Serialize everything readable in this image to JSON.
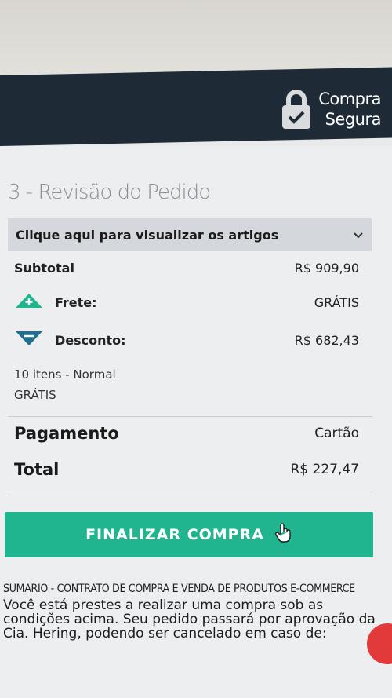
{
  "header": {
    "secure_line1": "Compra",
    "secure_line2": "Segura"
  },
  "review": {
    "step_title": "3 - Revisão do Pedido",
    "items_toggle_label": "Clique aqui para visualizar os artigos",
    "subtotal_label": "Subtotal",
    "subtotal_value": "R$ 909,90",
    "frete_label": "Frete:",
    "frete_value": "GRÁTIS",
    "desconto_label": "Desconto:",
    "desconto_value": "R$ 682,43",
    "shipping_info": "10 itens - Normal",
    "shipping_price": "GRÁTIS",
    "pagamento_label": "Pagamento",
    "pagamento_value": "Cartão",
    "total_label": "Total",
    "total_value": "R$ 227,47"
  },
  "actions": {
    "finalize_label": "FINALIZAR COMPRA"
  },
  "contract": {
    "title": "SUMARIO - CONTRATO DE COMPRA E VENDA DE PRODUTOS E-COMMERCE",
    "text": "Você está prestes a realizar uma compra sob as condições acima. Seu pedido passará por aprovação da Cia. Hering, podendo ser cancelado em caso de:"
  },
  "colors": {
    "header_bg": "#1f2a37",
    "accent_green": "#20b58e",
    "discount_blue": "#1f6d8f"
  }
}
